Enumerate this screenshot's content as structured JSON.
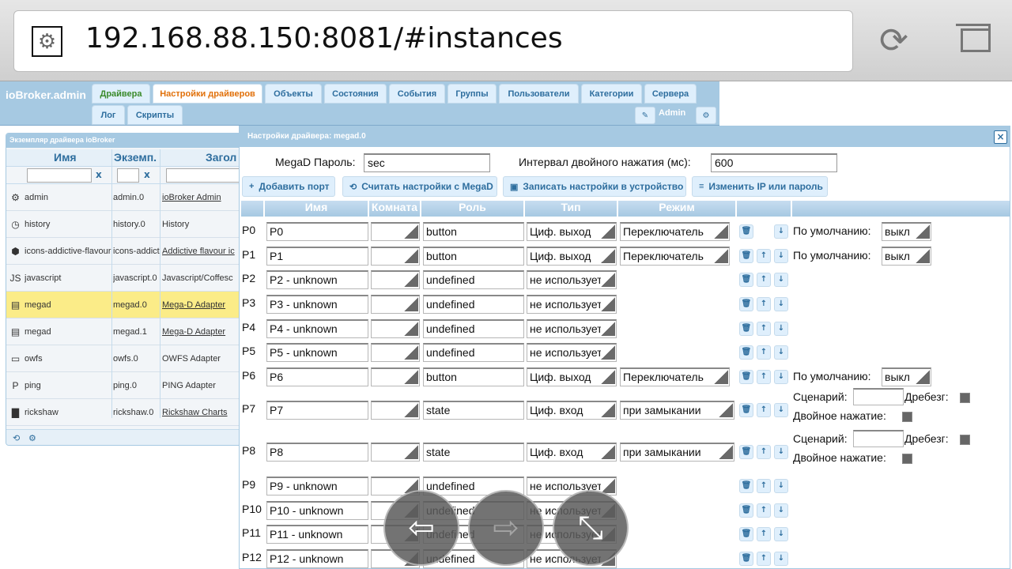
{
  "browser": {
    "url": "192.168.88.150:8081/#instances",
    "site_icon": "gear-icon",
    "reload_icon": "reload-icon",
    "tabs_icon": "tabs-icon"
  },
  "header": {
    "brand": "ioBroker.admin",
    "tabs": [
      "Драйвера",
      "Настройки драйверов",
      "Объекты",
      "Состояния",
      "События",
      "Группы",
      "Пользователи",
      "Категории",
      "Сервера"
    ],
    "tabs2": [
      "Лог",
      "Скрипты"
    ],
    "user": "Admin"
  },
  "instances": {
    "title": "Экземпляр драйвера ioBroker",
    "columns": [
      "Имя",
      "Экземп.",
      "Загол"
    ],
    "filter_clear": "x",
    "rows": [
      {
        "icon": "gear-icon",
        "name": "admin",
        "instance": "admin.0",
        "title": "ioBroker Admin",
        "link": true
      },
      {
        "icon": "clock-icon",
        "name": "history",
        "instance": "history.0",
        "title": "History",
        "link": false
      },
      {
        "icon": "shield-icon",
        "name": "icons-addictive-flavour",
        "instance": "icons-addictive",
        "title": "Addictive flavour ic",
        "link": true
      },
      {
        "icon": "js-icon",
        "name": "javascript",
        "instance": "javascript.0",
        "title": "Javascript/Coffesc",
        "link": false
      },
      {
        "icon": "board-icon",
        "name": "megad",
        "instance": "megad.0",
        "title": "Mega-D Adapter",
        "link": true
      },
      {
        "icon": "board-icon",
        "name": "megad",
        "instance": "megad.1",
        "title": "Mega-D Adapter",
        "link": true
      },
      {
        "icon": "owfs-icon",
        "name": "owfs",
        "instance": "owfs.0",
        "title": "OWFS Adapter",
        "link": false
      },
      {
        "icon": "ping-icon",
        "name": "ping",
        "instance": "ping.0",
        "title": "PING Adapter",
        "link": false
      },
      {
        "icon": "chart-icon",
        "name": "rickshaw",
        "instance": "rickshaw.0",
        "title": "Rickshaw Charts",
        "link": true
      }
    ]
  },
  "dialog": {
    "title": "Настройки драйвера: megad.0",
    "password_label": "MegaD Пароль:",
    "password_value": "sec",
    "interval_label": "Интервал двойного нажатия (мс):",
    "interval_value": "600",
    "buttons": {
      "add_port": "Добавить порт",
      "read": "Считать настройки с MegaD",
      "write": "Записать настройки в устройство",
      "change_ip": "Изменить IP или пароль"
    },
    "columns": [
      "Имя",
      "Комната",
      "Роль",
      "Тип",
      "Режим"
    ],
    "default_label": "По умолчанию:",
    "scenario_label": "Сценарий:",
    "bounce_label": "Дребезг:",
    "double_label": "Двойное нажатие:",
    "ports": [
      {
        "id": "P0",
        "name": "P0",
        "role": "button",
        "type": "Циф. выход",
        "mode": "Переключатель",
        "extra": "default",
        "default": "выкл",
        "up": false
      },
      {
        "id": "P1",
        "name": "P1",
        "role": "button",
        "type": "Циф. выход",
        "mode": "Переключатель",
        "extra": "default",
        "default": "выкл",
        "up": true
      },
      {
        "id": "P2",
        "name": "P2 - unknown",
        "role": "undefined",
        "type": "не используется",
        "mode": "",
        "extra": "",
        "default": "",
        "up": true
      },
      {
        "id": "P3",
        "name": "P3 - unknown",
        "role": "undefined",
        "type": "не используется",
        "mode": "",
        "extra": "",
        "default": "",
        "up": true
      },
      {
        "id": "P4",
        "name": "P4 - unknown",
        "role": "undefined",
        "type": "не используется",
        "mode": "",
        "extra": "",
        "default": "",
        "up": true
      },
      {
        "id": "P5",
        "name": "P5 - unknown",
        "role": "undefined",
        "type": "не используется",
        "mode": "",
        "extra": "",
        "default": "",
        "up": true
      },
      {
        "id": "P6",
        "name": "P6",
        "role": "button",
        "type": "Циф. выход",
        "mode": "Переключатель",
        "extra": "default",
        "default": "выкл",
        "up": true
      },
      {
        "id": "P7",
        "name": "P7",
        "role": "state",
        "type": "Циф. вход",
        "mode": "при замыкании",
        "extra": "input",
        "default": "",
        "up": true
      },
      {
        "id": "P8",
        "name": "P8",
        "role": "state",
        "type": "Циф. вход",
        "mode": "при замыкании",
        "extra": "input",
        "default": "",
        "up": true
      },
      {
        "id": "P9",
        "name": "P9 - unknown",
        "role": "undefined",
        "type": "не используется",
        "mode": "",
        "extra": "",
        "default": "",
        "up": true
      },
      {
        "id": "P10",
        "name": "P10 - unknown",
        "role": "undefined",
        "type": "не используется",
        "mode": "",
        "extra": "",
        "default": "",
        "up": true
      },
      {
        "id": "P11",
        "name": "P11 - unknown",
        "role": "undefined",
        "type": "не используется",
        "mode": "",
        "extra": "",
        "default": "",
        "up": true
      },
      {
        "id": "P12",
        "name": "P12 - unknown",
        "role": "undefined",
        "type": "не используется",
        "mode": "",
        "extra": "",
        "default": "",
        "up": true
      }
    ]
  },
  "overlay": {
    "back_icon": "back-arrow-icon",
    "forward_icon": "forward-arrow-icon",
    "fullscreen_icon": "collapse-fullscreen-icon"
  }
}
